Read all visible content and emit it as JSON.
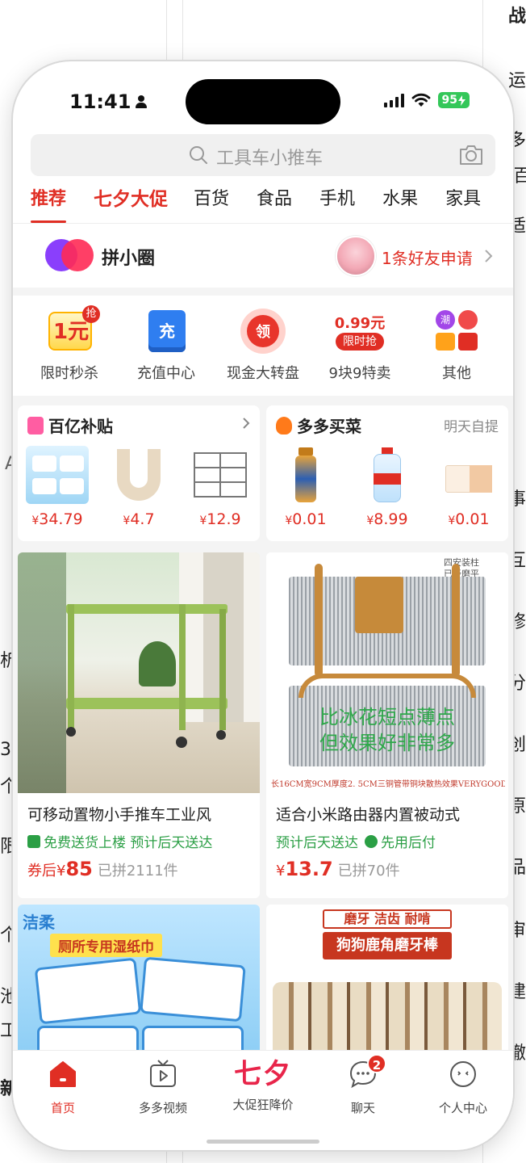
{
  "background": {
    "right_glimpses": [
      "战",
      "运",
      "多",
      "'百",
      "适",
      "事",
      "互",
      "修",
      "分",
      "创",
      "原",
      "品",
      "审",
      "建",
      "撤"
    ],
    "left_glimpses": [
      "析",
      "3",
      "个",
      "限",
      "个",
      "池",
      "工",
      "新",
      "A"
    ]
  },
  "status_bar": {
    "time": "11:41",
    "battery": "95"
  },
  "search": {
    "placeholder": "工具车小推车"
  },
  "tabs": [
    "推荐",
    "七夕大促",
    "百货",
    "食品",
    "手机",
    "水果",
    "家具"
  ],
  "circle": {
    "title": "拼小圈",
    "friend_request": "1条好友申请"
  },
  "quick_entries": [
    {
      "label": "限时秒杀",
      "icon": "one-yuan-flash-sale-icon",
      "icon_text": "1元",
      "corner_text": "抢"
    },
    {
      "label": "充值中心",
      "icon": "recharge-icon",
      "icon_text": "充"
    },
    {
      "label": "现金大转盘",
      "icon": "cash-wheel-icon",
      "icon_text": "领"
    },
    {
      "label": "9块9特卖",
      "icon": "nine-nine-sale-icon",
      "icon_text": "0.99元",
      "icon_sub": "限时抢"
    },
    {
      "label": "其他",
      "icon": "more-apps-icon",
      "icon_text": "潮"
    }
  ],
  "billion_subsidy": {
    "title": "百亿补贴",
    "items": [
      {
        "price": "34.79",
        "thumb": "wet-wipes-pack"
      },
      {
        "price": "4.7",
        "thumb": "u-shaped-pillow"
      },
      {
        "price": "12.9",
        "thumb": "wire-rack"
      }
    ]
  },
  "grocery": {
    "title": "多多买菜",
    "extra": "明天自提",
    "items": [
      {
        "price": "0.01",
        "thumb": "tea-bottle"
      },
      {
        "price": "8.99",
        "thumb": "water-jug"
      },
      {
        "price": "0.01",
        "thumb": "tissue-box"
      }
    ]
  },
  "currency": "¥",
  "products": [
    {
      "title": "可移动置物小手推车工业风",
      "tags": "免费送货上楼 预计后天送达",
      "price_prefix": "券后",
      "price": "85",
      "sold": "已拼2111件",
      "image": "green-utility-cart"
    },
    {
      "title": "适合小米路由器内置被动式",
      "tags": "预计后天送达",
      "tag_extra": "先用后付",
      "price": "13.7",
      "sold": "已拼70件",
      "image": "copper-heatsink",
      "image_caption_top": "四安装柱\n已经磨平",
      "image_overlay": "比冰花短点薄点\n但效果好非常多",
      "image_caption_bottom": "长16CM宽9CM厚度2. 5CM三铜管带铜块散热效果VERYGOOD"
    },
    {
      "brand": "洁柔",
      "banner": "厕所专用湿纸巾",
      "image": "toilet-wet-wipes"
    },
    {
      "banner_top": "磨牙 洁齿 耐啃",
      "banner_main": "狗狗鹿角磨牙棒",
      "image": "deer-antler-chews"
    }
  ],
  "bottom_nav": [
    {
      "label": "首页",
      "icon": "home-icon",
      "active": true
    },
    {
      "label": "多多视频",
      "icon": "video-tv-icon"
    },
    {
      "label": "大促狂降价",
      "icon": "qixi-promo-icon",
      "logo_text": "七夕"
    },
    {
      "label": "聊天",
      "icon": "chat-icon",
      "badge": "2"
    },
    {
      "label": "个人中心",
      "icon": "profile-icon"
    }
  ],
  "colors": {
    "accent": "#e02e24",
    "promo": "#e8254a",
    "green": "#2b9f45",
    "battery": "#34c759"
  }
}
